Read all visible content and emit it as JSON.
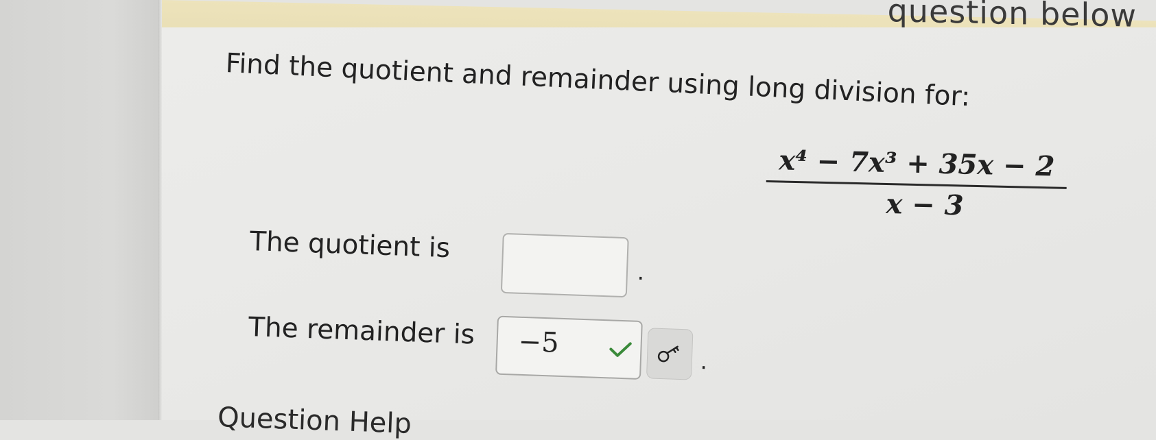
{
  "header": {
    "partial_text": "question below"
  },
  "problem": {
    "prompt": "Find the quotient and remainder using long division for:",
    "numerator": "x⁴ − 7x³ + 35x − 2",
    "denominator": "x − 3"
  },
  "quotient": {
    "label": "The quotient is",
    "value": "",
    "period": "."
  },
  "remainder": {
    "label": "The remainder is",
    "value": "−5",
    "period": "."
  },
  "footer": {
    "partial_link": "Question Help"
  },
  "icons": {
    "check": "check-icon",
    "hint": "key-icon"
  },
  "colors": {
    "check_green": "#3a8a3a",
    "page_bg": "#e8e8e6",
    "header_tan": "#ece2b9"
  }
}
